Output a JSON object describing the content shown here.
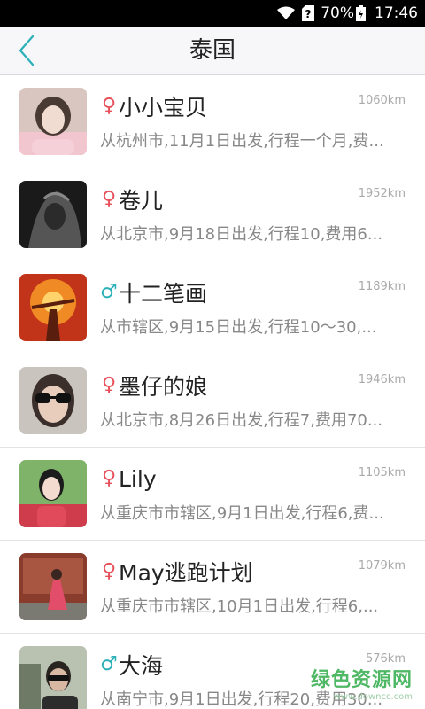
{
  "status_bar": {
    "battery": "70%",
    "time": "17:46",
    "icons": [
      "wifi-icon",
      "no-sim-icon",
      "battery-icon"
    ]
  },
  "header": {
    "back_icon": "chevron-left-icon",
    "title": "泰国"
  },
  "colors": {
    "accent": "#2bb0b8",
    "female": "#e8505b",
    "male": "#2bb0b8"
  },
  "list": [
    {
      "gender": "♀",
      "gender_type": "female",
      "name": "小小宝贝",
      "distance": "1060km",
      "desc": "从杭州市,11月1日出发,行程一个月,费...",
      "avatar": "avatar-photo-1"
    },
    {
      "gender": "♀",
      "gender_type": "female",
      "name": "卷儿",
      "distance": "1952km",
      "desc": "从北京市,9月18日出发,行程10,费用6...",
      "avatar": "avatar-photo-2"
    },
    {
      "gender": "♂",
      "gender_type": "male",
      "name": "十二笔画",
      "distance": "1189km",
      "desc": "从市辖区,9月15日出发,行程10～30,...",
      "avatar": "avatar-photo-3"
    },
    {
      "gender": "♀",
      "gender_type": "female",
      "name": "墨仔的娘",
      "distance": "1946km",
      "desc": "从北京市,8月26日出发,行程7,费用70...",
      "avatar": "avatar-photo-4"
    },
    {
      "gender": "♀",
      "gender_type": "female",
      "name": "Lily",
      "distance": "1105km",
      "desc": "从重庆市市辖区,9月1日出发,行程6,费...",
      "avatar": "avatar-photo-5"
    },
    {
      "gender": "♀",
      "gender_type": "female",
      "name": "May逃跑计划",
      "distance": "1079km",
      "desc": "从重庆市市辖区,10月1日出发,行程6,...",
      "avatar": "avatar-photo-6"
    },
    {
      "gender": "♂",
      "gender_type": "male",
      "name": "大海",
      "distance": "576km",
      "desc": "从南宁市,9月1日出发,行程20,费用30...",
      "avatar": "avatar-photo-7"
    }
  ],
  "watermark": {
    "main": "绿色资源网",
    "url": "www.downcc.com"
  }
}
